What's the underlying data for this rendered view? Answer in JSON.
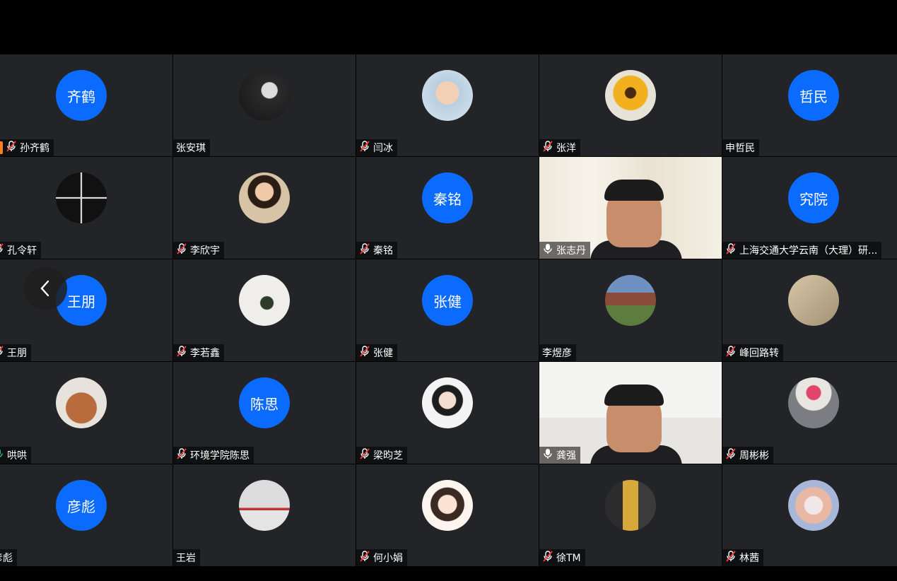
{
  "participants": [
    {
      "name": "孙齐鹤",
      "avatar_text": "齐鹤",
      "mic": "muted",
      "kind": "initials",
      "extra_badge": true
    },
    {
      "name": "张安琪",
      "avatar_text": "",
      "mic": "none",
      "kind": "photo",
      "photo": "dark"
    },
    {
      "name": "闫冰",
      "avatar_text": "",
      "mic": "muted",
      "kind": "photo",
      "photo": "child"
    },
    {
      "name": "张洋",
      "avatar_text": "",
      "mic": "muted",
      "kind": "photo",
      "photo": "sunflower"
    },
    {
      "name": "申哲民",
      "avatar_text": "哲民",
      "mic": "none",
      "kind": "initials"
    },
    {
      "name": "孔令轩",
      "avatar_text": "",
      "mic": "muted",
      "kind": "photo",
      "photo": "cross"
    },
    {
      "name": "李欣宇",
      "avatar_text": "",
      "mic": "muted",
      "kind": "photo",
      "photo": "girl"
    },
    {
      "name": "秦铭",
      "avatar_text": "秦铭",
      "mic": "muted",
      "kind": "initials"
    },
    {
      "name": "张志丹",
      "avatar_text": "",
      "mic": "active",
      "kind": "video",
      "video": "calligraphy"
    },
    {
      "name": "上海交通大学云南（大理）研...",
      "avatar_text": "究院",
      "mic": "muted",
      "kind": "initials"
    },
    {
      "name": "王朋",
      "avatar_text": "王朋",
      "mic": "muted",
      "kind": "initials"
    },
    {
      "name": "李若鑫",
      "avatar_text": "",
      "mic": "muted",
      "kind": "photo",
      "photo": "white"
    },
    {
      "name": "张健",
      "avatar_text": "张健",
      "mic": "muted",
      "kind": "initials"
    },
    {
      "name": "李煜彦",
      "avatar_text": "",
      "mic": "none",
      "kind": "photo",
      "photo": "campus"
    },
    {
      "name": "峰回路转",
      "avatar_text": "",
      "mic": "muted",
      "kind": "photo",
      "photo": "shadow"
    },
    {
      "name": "哄哄",
      "avatar_text": "",
      "mic": "active-green",
      "kind": "photo",
      "photo": "dog"
    },
    {
      "name": "环境学院陈思",
      "avatar_text": "陈思",
      "mic": "muted",
      "kind": "initials"
    },
    {
      "name": "梁昀芝",
      "avatar_text": "",
      "mic": "muted",
      "kind": "photo",
      "photo": "cartoon"
    },
    {
      "name": "龚强",
      "avatar_text": "",
      "mic": "active",
      "kind": "video",
      "video": "office"
    },
    {
      "name": "周彬彬",
      "avatar_text": "",
      "mic": "muted",
      "kind": "photo",
      "photo": "redhat"
    },
    {
      "name": "彦彪",
      "avatar_text": "彦彪",
      "mic": "none",
      "kind": "initials"
    },
    {
      "name": "王岩",
      "avatar_text": "",
      "mic": "none",
      "kind": "photo",
      "photo": "basketball"
    },
    {
      "name": "何小娟",
      "avatar_text": "",
      "mic": "muted",
      "kind": "photo",
      "photo": "cartoon2"
    },
    {
      "name": "徐TM",
      "avatar_text": "",
      "mic": "muted",
      "kind": "photo",
      "photo": "street"
    },
    {
      "name": "林茜",
      "avatar_text": "",
      "mic": "muted",
      "kind": "photo",
      "photo": "pastel"
    }
  ],
  "colors": {
    "avatar_blue": "#0b6bff",
    "tile_bg": "#232427",
    "active_green": "#2fbf71"
  }
}
